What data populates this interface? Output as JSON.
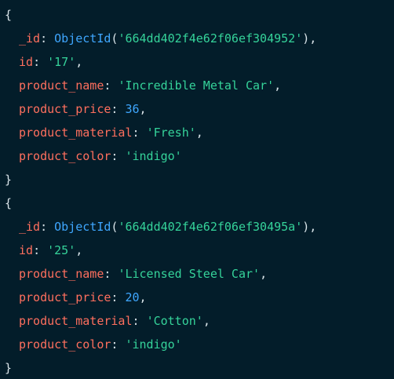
{
  "documents": [
    {
      "open_brace": "{",
      "close_brace": "}",
      "fields": [
        {
          "key": "_id",
          "kind": "objectid",
          "fn": "ObjectId",
          "value": "'664dd402f4e62f06ef304952'"
        },
        {
          "key": "id",
          "kind": "string",
          "value": "'17'"
        },
        {
          "key": "product_name",
          "kind": "string",
          "value": "'Incredible Metal Car'"
        },
        {
          "key": "product_price",
          "kind": "number",
          "value": "36"
        },
        {
          "key": "product_material",
          "kind": "string",
          "value": "'Fresh'"
        },
        {
          "key": "product_color",
          "kind": "string",
          "value": "'indigo'"
        }
      ]
    },
    {
      "open_brace": "{",
      "close_brace": "}",
      "fields": [
        {
          "key": "_id",
          "kind": "objectid",
          "fn": "ObjectId",
          "value": "'664dd402f4e62f06ef30495a'"
        },
        {
          "key": "id",
          "kind": "string",
          "value": "'25'"
        },
        {
          "key": "product_name",
          "kind": "string",
          "value": "'Licensed Steel Car'"
        },
        {
          "key": "product_price",
          "kind": "number",
          "value": "20"
        },
        {
          "key": "product_material",
          "kind": "string",
          "value": "'Cotton'"
        },
        {
          "key": "product_color",
          "kind": "string",
          "value": "'indigo'"
        }
      ]
    }
  ],
  "colors": {
    "background": "#031d2a",
    "key": "#ff6f5e",
    "string": "#35d39a",
    "number": "#3fa7ff",
    "function": "#3fa7ff",
    "punctuation": "#d9e4e9"
  }
}
